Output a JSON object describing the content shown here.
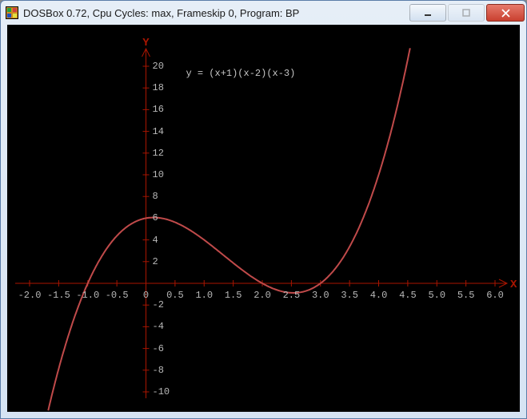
{
  "window": {
    "title": "DOSBox 0.72, Cpu Cycles:     max, Frameskip  0, Program:       BP",
    "minimize_label": "Minimize",
    "maximize_label": "Maximize",
    "close_label": "Close"
  },
  "plot": {
    "equation": "y = (x+1)(x-2)(x-3)",
    "x_axis_name": "X",
    "y_axis_name": "Y"
  },
  "chart_data": {
    "type": "line",
    "title": "y = (x+1)(x-2)(x-3)",
    "xlabel": "X",
    "ylabel": "Y",
    "xlim": [
      -2.0,
      6.0
    ],
    "ylim": [
      -10,
      20
    ],
    "x_ticks": [
      -2.0,
      -1.5,
      -1.0,
      -0.5,
      0,
      0.5,
      1.0,
      1.5,
      2.0,
      2.5,
      3.0,
      3.5,
      4.0,
      4.5,
      5.0,
      5.5,
      6.0
    ],
    "y_ticks": [
      -10,
      -8,
      -6,
      -4,
      -2,
      2,
      4,
      6,
      8,
      10,
      12,
      14,
      16,
      18,
      20
    ],
    "series": [
      {
        "name": "(x+1)(x-2)(x-3)",
        "color": "#c04a4a",
        "x": [
          -1.5,
          -1.25,
          -1.0,
          -0.75,
          -0.5,
          -0.25,
          0.0,
          0.25,
          0.5,
          0.75,
          1.0,
          1.25,
          1.5,
          1.75,
          2.0,
          2.25,
          2.5,
          2.75,
          3.0,
          3.25,
          3.5,
          3.75,
          4.0,
          4.25,
          4.5
        ],
        "y": [
          -7.875,
          -3.4531,
          0.0,
          2.5781,
          4.375,
          5.4844,
          6.0,
          6.0156,
          5.625,
          4.9219,
          4.0,
          2.9531,
          1.875,
          0.8594,
          0.0,
          -0.6094,
          -0.875,
          -0.7031,
          0.0,
          1.3281,
          3.375,
          6.2344,
          10.0,
          14.7656,
          20.625
        ]
      }
    ]
  }
}
